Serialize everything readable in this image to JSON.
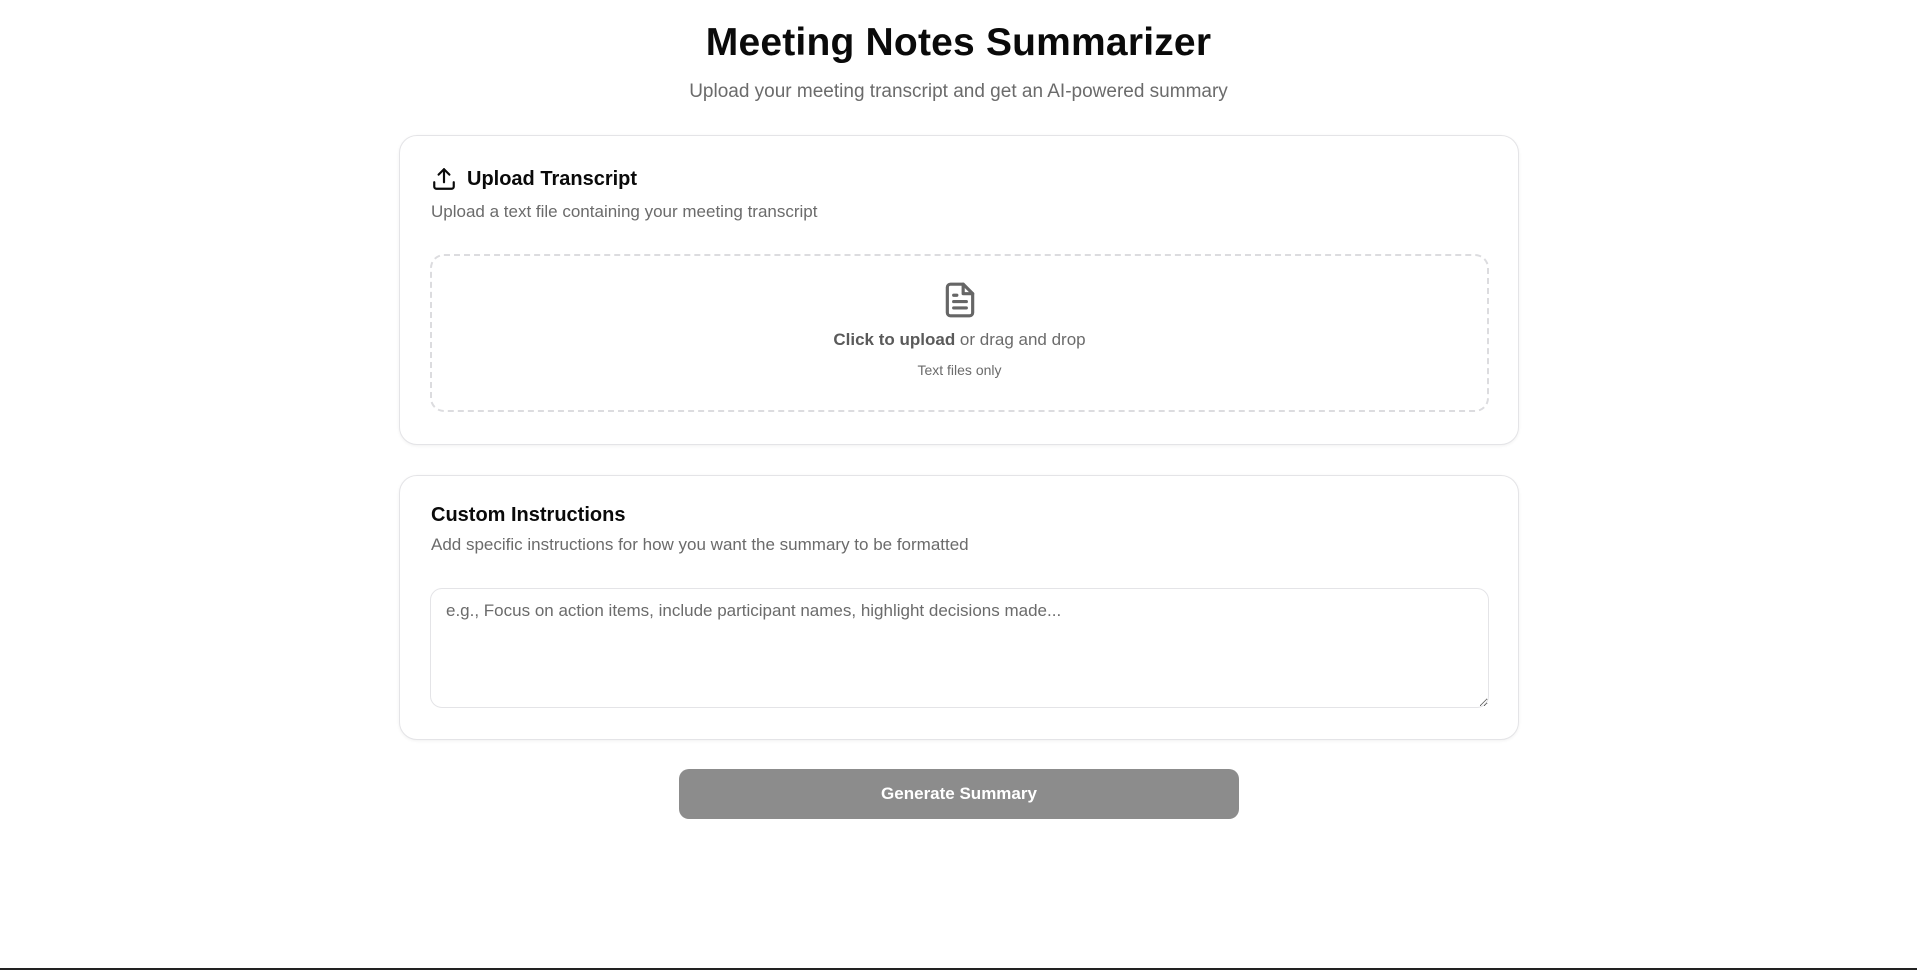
{
  "header": {
    "title": "Meeting Notes Summarizer",
    "subtitle": "Upload your meeting transcript and get an AI-powered summary"
  },
  "upload_card": {
    "title": "Upload Transcript",
    "description": "Upload a text file containing your meeting transcript",
    "icon": "upload-icon",
    "dropzone": {
      "icon": "file-text-icon",
      "click_label": "Click to upload",
      "drag_label": " or drag and drop",
      "hint": "Text files only"
    }
  },
  "instructions_card": {
    "title": "Custom Instructions",
    "description": "Add specific instructions for how you want the summary to be formatted",
    "textarea_value": "",
    "textarea_placeholder": "e.g., Focus on action items, include participant names, highlight decisions made..."
  },
  "actions": {
    "generate_label": "Generate Summary",
    "generate_color": "#8c8c8c"
  }
}
